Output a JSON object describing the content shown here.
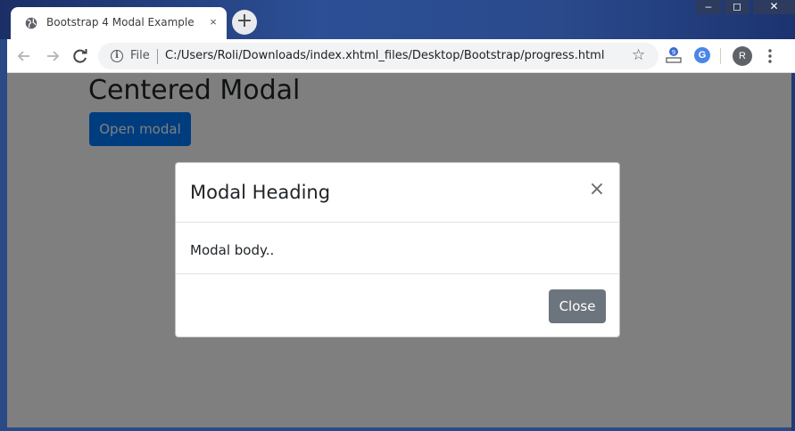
{
  "browser": {
    "tab_title": "Bootstrap 4 Modal Example",
    "tab_close": "×",
    "new_tab": "+",
    "window_controls": {
      "minimize": "–",
      "maximize": "◻",
      "close": "✕"
    },
    "nav": {
      "back_icon": "arrow-left-icon",
      "forward_icon": "arrow-right-icon",
      "reload_icon": "reload-icon"
    },
    "omnibox": {
      "scheme_label": "File",
      "url": "C:/Users/Roli/Downloads/index.xhtml_files/Desktop/Bootstrap/progress.html"
    },
    "profile_initial": "R",
    "extension_initial": "G"
  },
  "page": {
    "heading": "Centered Modal",
    "open_button": "Open modal"
  },
  "modal": {
    "title": "Modal Heading",
    "close_x": "×",
    "body": "Modal body..",
    "close_button": "Close"
  },
  "colors": {
    "primary": "#007bff",
    "secondary": "#6c757d",
    "backdrop": "rgba(0,0,0,0.5)"
  }
}
